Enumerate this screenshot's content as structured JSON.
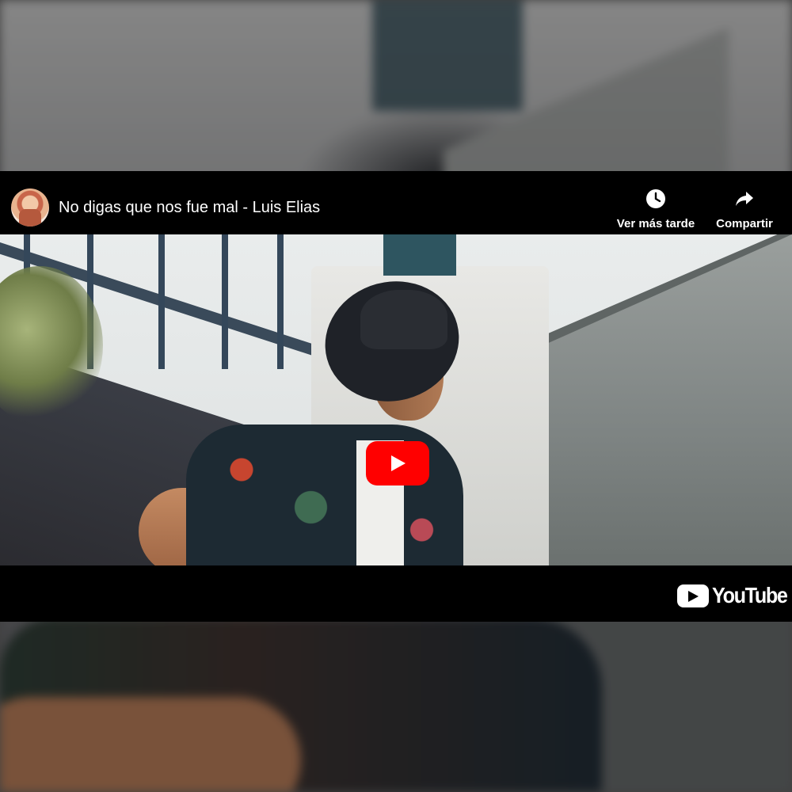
{
  "video": {
    "title": "No digas que nos fue mal - Luis Elias"
  },
  "actions": {
    "watch_later_label": "Ver más tarde",
    "watch_later_icon": "clock-icon",
    "share_label": "Compartir",
    "share_icon": "share-arrow-icon"
  },
  "player": {
    "play_icon": "play-icon",
    "play_color": "#FF0000"
  },
  "branding": {
    "logo_text": "YouTube",
    "logo_icon": "youtube-play-mark-icon"
  }
}
